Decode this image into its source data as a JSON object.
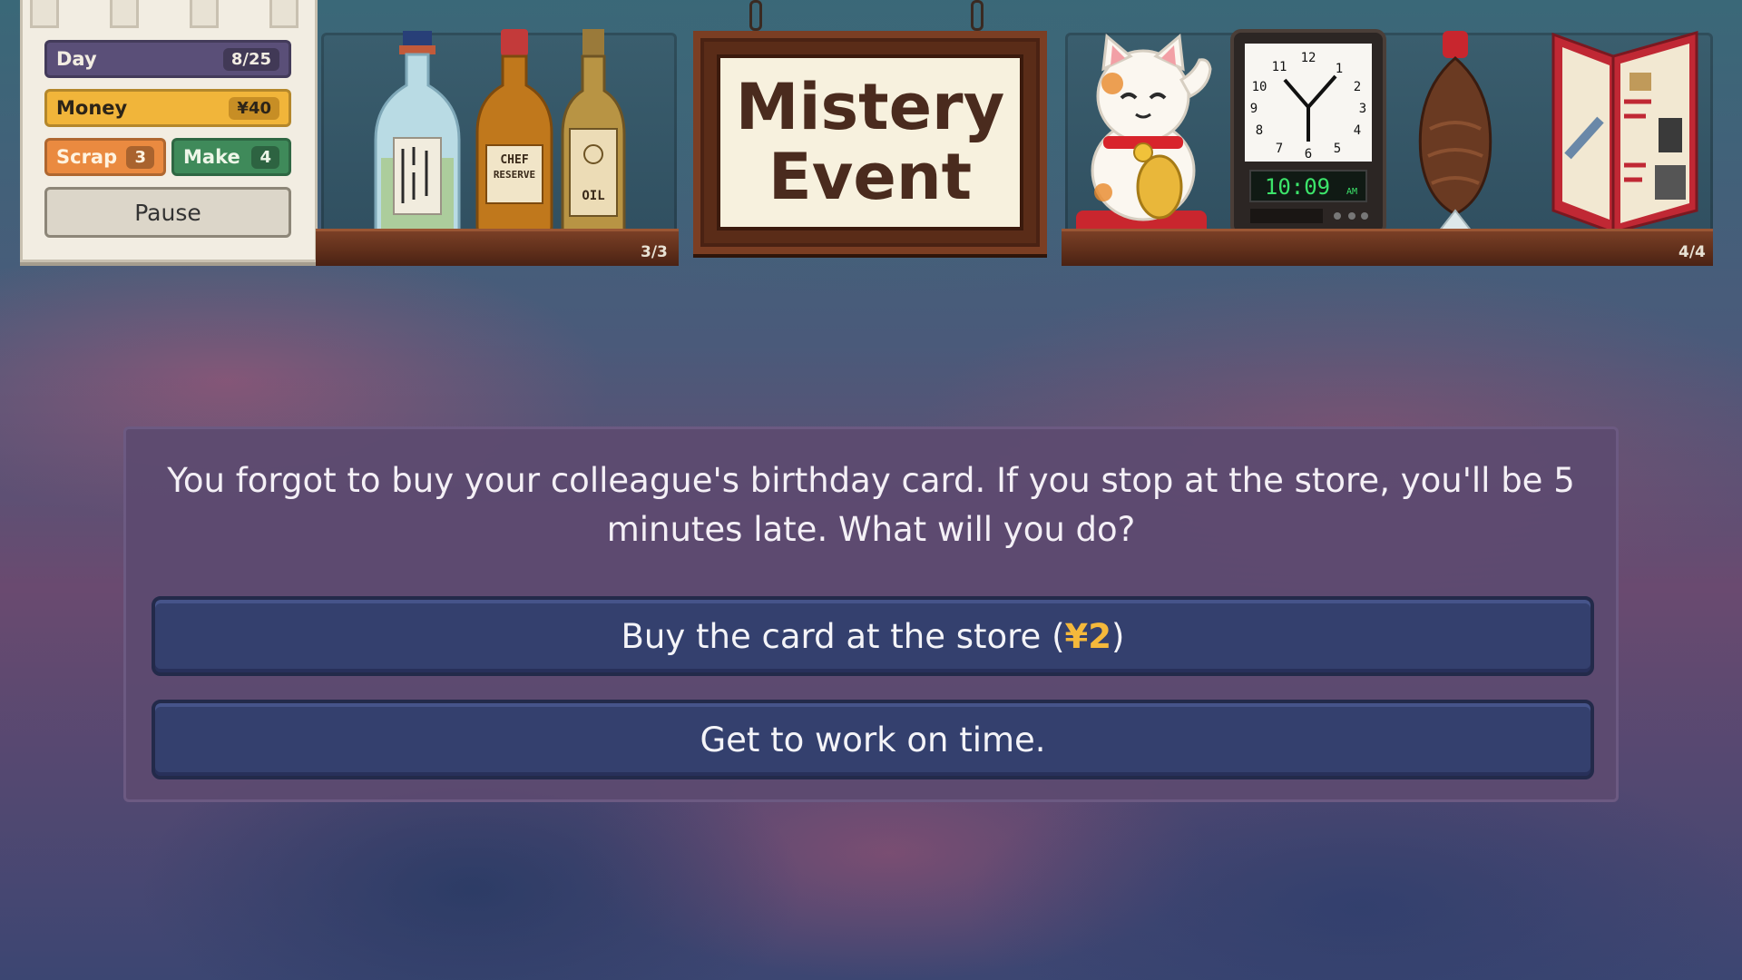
{
  "stats": {
    "day_label": "Day",
    "day_value": "8/25",
    "money_label": "Money",
    "money_value": "¥40",
    "scrap_label": "Scrap",
    "scrap_value": "3",
    "make_label": "Make",
    "make_value": "4",
    "pause_label": "Pause"
  },
  "left_shelf": {
    "count": "3/3",
    "items": [
      {
        "icon": "sake-bottle-icon"
      },
      {
        "icon": "chef-reserve-bottle-icon",
        "label": "CHEF RESERVE"
      },
      {
        "icon": "oil-bottle-icon",
        "label": "OIL"
      }
    ]
  },
  "sign": {
    "line1": "Mistery",
    "line2": "Event"
  },
  "right_shelf": {
    "count": "4/4",
    "items": [
      {
        "icon": "lucky-cat-icon"
      },
      {
        "icon": "clock-icon",
        "time": "10:09",
        "suffix": "AM"
      },
      {
        "icon": "fish-soy-sauce-icon"
      },
      {
        "icon": "recipe-book-icon"
      }
    ]
  },
  "event": {
    "prompt": "You forgot to buy your colleague's birthday card. If you stop at the store, you'll be 5 minutes late. What will you do?",
    "choices": [
      {
        "text": "Buy the card at the store (",
        "cost": "¥2",
        "close": ")"
      },
      {
        "text": "Get to work on time."
      }
    ]
  },
  "colors": {
    "day": "#5a4f78",
    "money": "#f1b53a",
    "scrap": "#ea8a40",
    "make": "#3f8a5a",
    "cost": "#f5b93b",
    "panel": "#5c4a70",
    "choice": "#34406e"
  }
}
